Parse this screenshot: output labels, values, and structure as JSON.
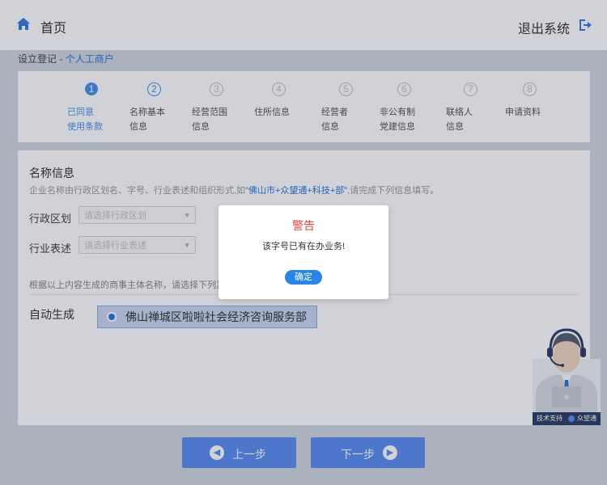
{
  "header": {
    "home_label": "首页",
    "logout_label": "退出系统"
  },
  "breadcrumb": {
    "root": "设立登记",
    "separator": "-",
    "current": "个人工商户"
  },
  "steps": [
    {
      "num": "1",
      "label": "已同意\n使用条款",
      "state": "done"
    },
    {
      "num": "2",
      "label": "名称基本\n信息",
      "state": "current"
    },
    {
      "num": "3",
      "label": "经营范围\n信息",
      "state": "pending"
    },
    {
      "num": "4",
      "label": "住所信息",
      "state": "pending"
    },
    {
      "num": "5",
      "label": "经营者\n信息",
      "state": "pending"
    },
    {
      "num": "6",
      "label": "非公有制\n党建信息",
      "state": "pending"
    },
    {
      "num": "7",
      "label": "联络人\n信息",
      "state": "pending"
    },
    {
      "num": "8",
      "label": "申请资料",
      "state": "pending"
    }
  ],
  "form": {
    "section_title": "名称信息",
    "desc_prefix": "企业名称由行政区划名、字号、行业表述和组织形式,如",
    "desc_example": "\"佛山市+众望通+科技+部\"",
    "desc_suffix": ",请完成下列信息填写。",
    "region_label": "行政区划",
    "region_placeholder": "请选择行政区划",
    "industry_label": "行业表述",
    "industry_placeholder": "请选择行业表述",
    "hint": "根据以上内容生成的商事主体名称，请选择下列其",
    "auto_label": "自动生成",
    "generated_name": "佛山禅城区啦啦社会经济咨询服务部"
  },
  "buttons": {
    "prev": "上一步",
    "next": "下一步"
  },
  "support": {
    "tech_label": "技术支持",
    "brand": "众望通"
  },
  "modal": {
    "title": "警告",
    "message": "该字号已有在办业务!",
    "confirm": "确定"
  },
  "colors": {
    "accent": "#2b74d8",
    "warning": "#e0443c",
    "button": "#5b8ef0"
  }
}
